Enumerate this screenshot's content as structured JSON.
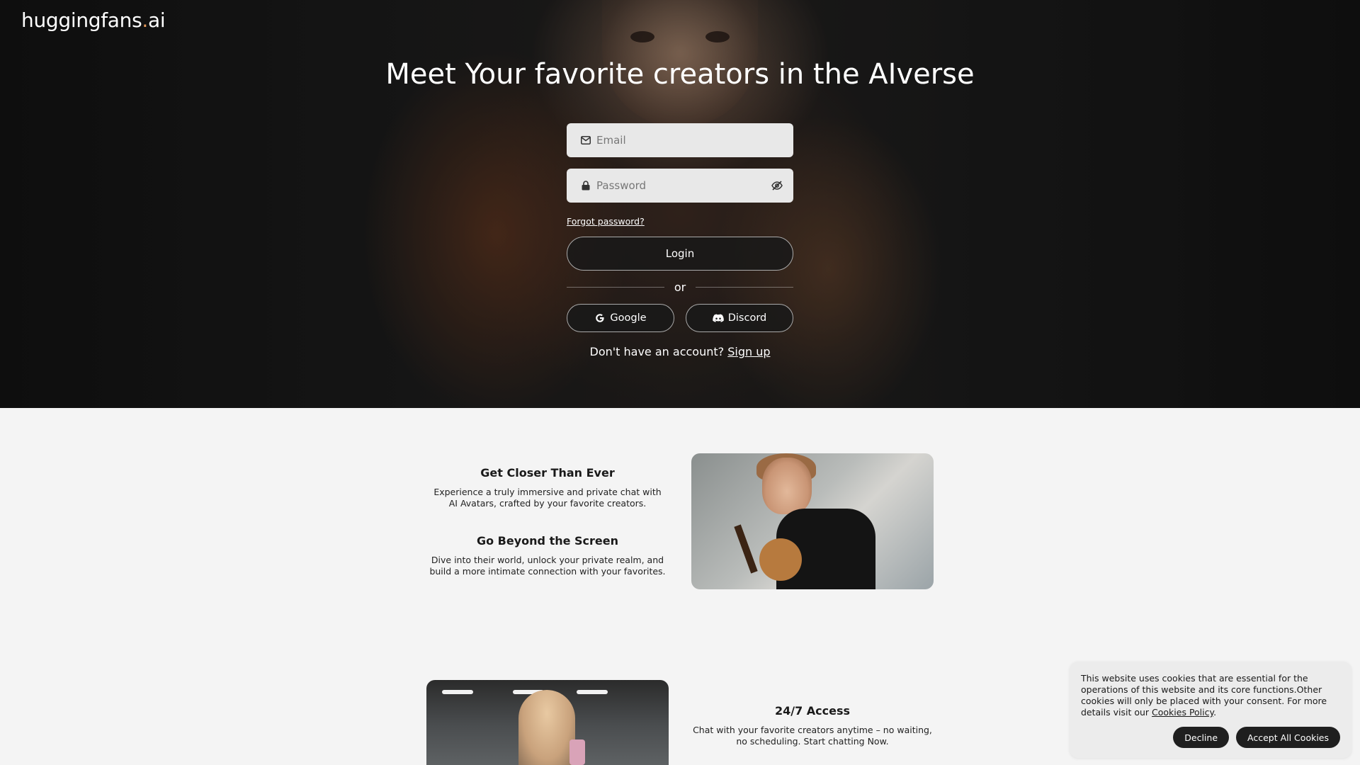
{
  "brand": {
    "logo_main": "huggingfans",
    "logo_dot": ".",
    "logo_tld": "ai"
  },
  "hero": {
    "title": "Meet Your favorite creators in the AIverse",
    "email_placeholder": "Email",
    "password_placeholder": "Password",
    "forgot_password": "Forgot password?",
    "login_label": "Login",
    "or_text": "or",
    "google_label": "Google",
    "discord_label": "Discord",
    "signup_prompt": "Don't have an account?",
    "signup_link": "Sign up"
  },
  "features": [
    {
      "title": "Get Closer Than Ever",
      "text": "Experience a truly immersive and private chat with AI Avatars, crafted by your favorite creators."
    },
    {
      "title": "Go Beyond the Screen",
      "text": "Dive into their world, unlock your private realm, and build a more intimate connection with your favorites."
    },
    {
      "title": "24/7 Access",
      "text": "Chat with your favorite creators anytime – no waiting, no scheduling. Start chatting Now."
    }
  ],
  "cookie": {
    "text": "This website uses cookies that are essential for the operations of this website and its core functions.Other cookies will only be placed with your consent. For more details visit our ",
    "policy_link": "Cookies Policy",
    "trailing": ".",
    "decline_label": "Decline",
    "accept_label": "Accept All Cookies"
  },
  "icons": {
    "email": "envelope-icon",
    "password": "lock-icon",
    "visibility": "eye-off-icon",
    "google": "google-g-icon",
    "discord": "discord-icon"
  },
  "colors": {
    "logo_dot": "#e79a5a",
    "button_dark": "#1f1f1f",
    "page_bg": "#f4f4f4"
  }
}
